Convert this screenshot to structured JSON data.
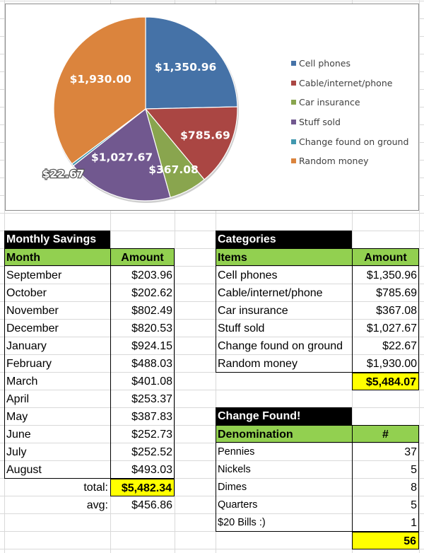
{
  "chart_data": {
    "type": "pie",
    "title": "",
    "categories": [
      "Cell phones",
      "Cable/internet/phone",
      "Car insurance",
      "Stuff sold",
      "Change found on ground",
      "Random money"
    ],
    "values": [
      1350.96,
      785.69,
      367.08,
      1027.67,
      22.67,
      1930.0
    ],
    "data_labels": [
      "$1,350.96",
      "$785.69",
      "$367.08",
      "$1,027.67",
      "$22.67",
      "$1,930.00"
    ],
    "colors": [
      "#4572A7",
      "#AA4643",
      "#89A54E",
      "#71588F",
      "#4198AF",
      "#DB843D"
    ],
    "start": "12 o'clock, clockwise",
    "legend_position": "right"
  },
  "monthly_savings": {
    "title": "Monthly Savings",
    "headers": [
      "Month",
      "Amount"
    ],
    "rows": [
      {
        "month": "September",
        "amount": "$203.96"
      },
      {
        "month": "October",
        "amount": "$202.62"
      },
      {
        "month": "November",
        "amount": "$802.49"
      },
      {
        "month": "December",
        "amount": "$820.53"
      },
      {
        "month": "January",
        "amount": "$924.15"
      },
      {
        "month": "February",
        "amount": "$488.03"
      },
      {
        "month": "March",
        "amount": "$401.08"
      },
      {
        "month": "April",
        "amount": "$253.37"
      },
      {
        "month": "May",
        "amount": "$387.83"
      },
      {
        "month": "June",
        "amount": "$252.73"
      },
      {
        "month": "July",
        "amount": "$252.52"
      },
      {
        "month": "August",
        "amount": "$493.03"
      }
    ],
    "total_label": "total:",
    "total": "$5,482.34",
    "avg_label": "avg:",
    "avg": "$456.86"
  },
  "categories_table": {
    "title": "Categories",
    "headers": [
      "Items",
      "Amount"
    ],
    "rows": [
      {
        "item": "Cell phones",
        "amount": "$1,350.96"
      },
      {
        "item": "Cable/internet/phone",
        "amount": "$785.69"
      },
      {
        "item": "Car insurance",
        "amount": "$367.08"
      },
      {
        "item": "Stuff sold",
        "amount": "$1,027.67"
      },
      {
        "item": "Change found on ground",
        "amount": "$22.67"
      },
      {
        "item": "Random money",
        "amount": "$1,930.00"
      }
    ],
    "total": "$5,484.07"
  },
  "change_found": {
    "title": "Change Found!",
    "headers": [
      "Denomination",
      "#"
    ],
    "rows": [
      {
        "denomination": "Pennies",
        "count": "37"
      },
      {
        "denomination": "Nickels",
        "count": "5"
      },
      {
        "denomination": "Dimes",
        "count": "8"
      },
      {
        "denomination": "Quarters",
        "count": "5"
      },
      {
        "denomination": "$20 Bills :)",
        "count": "1"
      }
    ],
    "total": "56"
  }
}
